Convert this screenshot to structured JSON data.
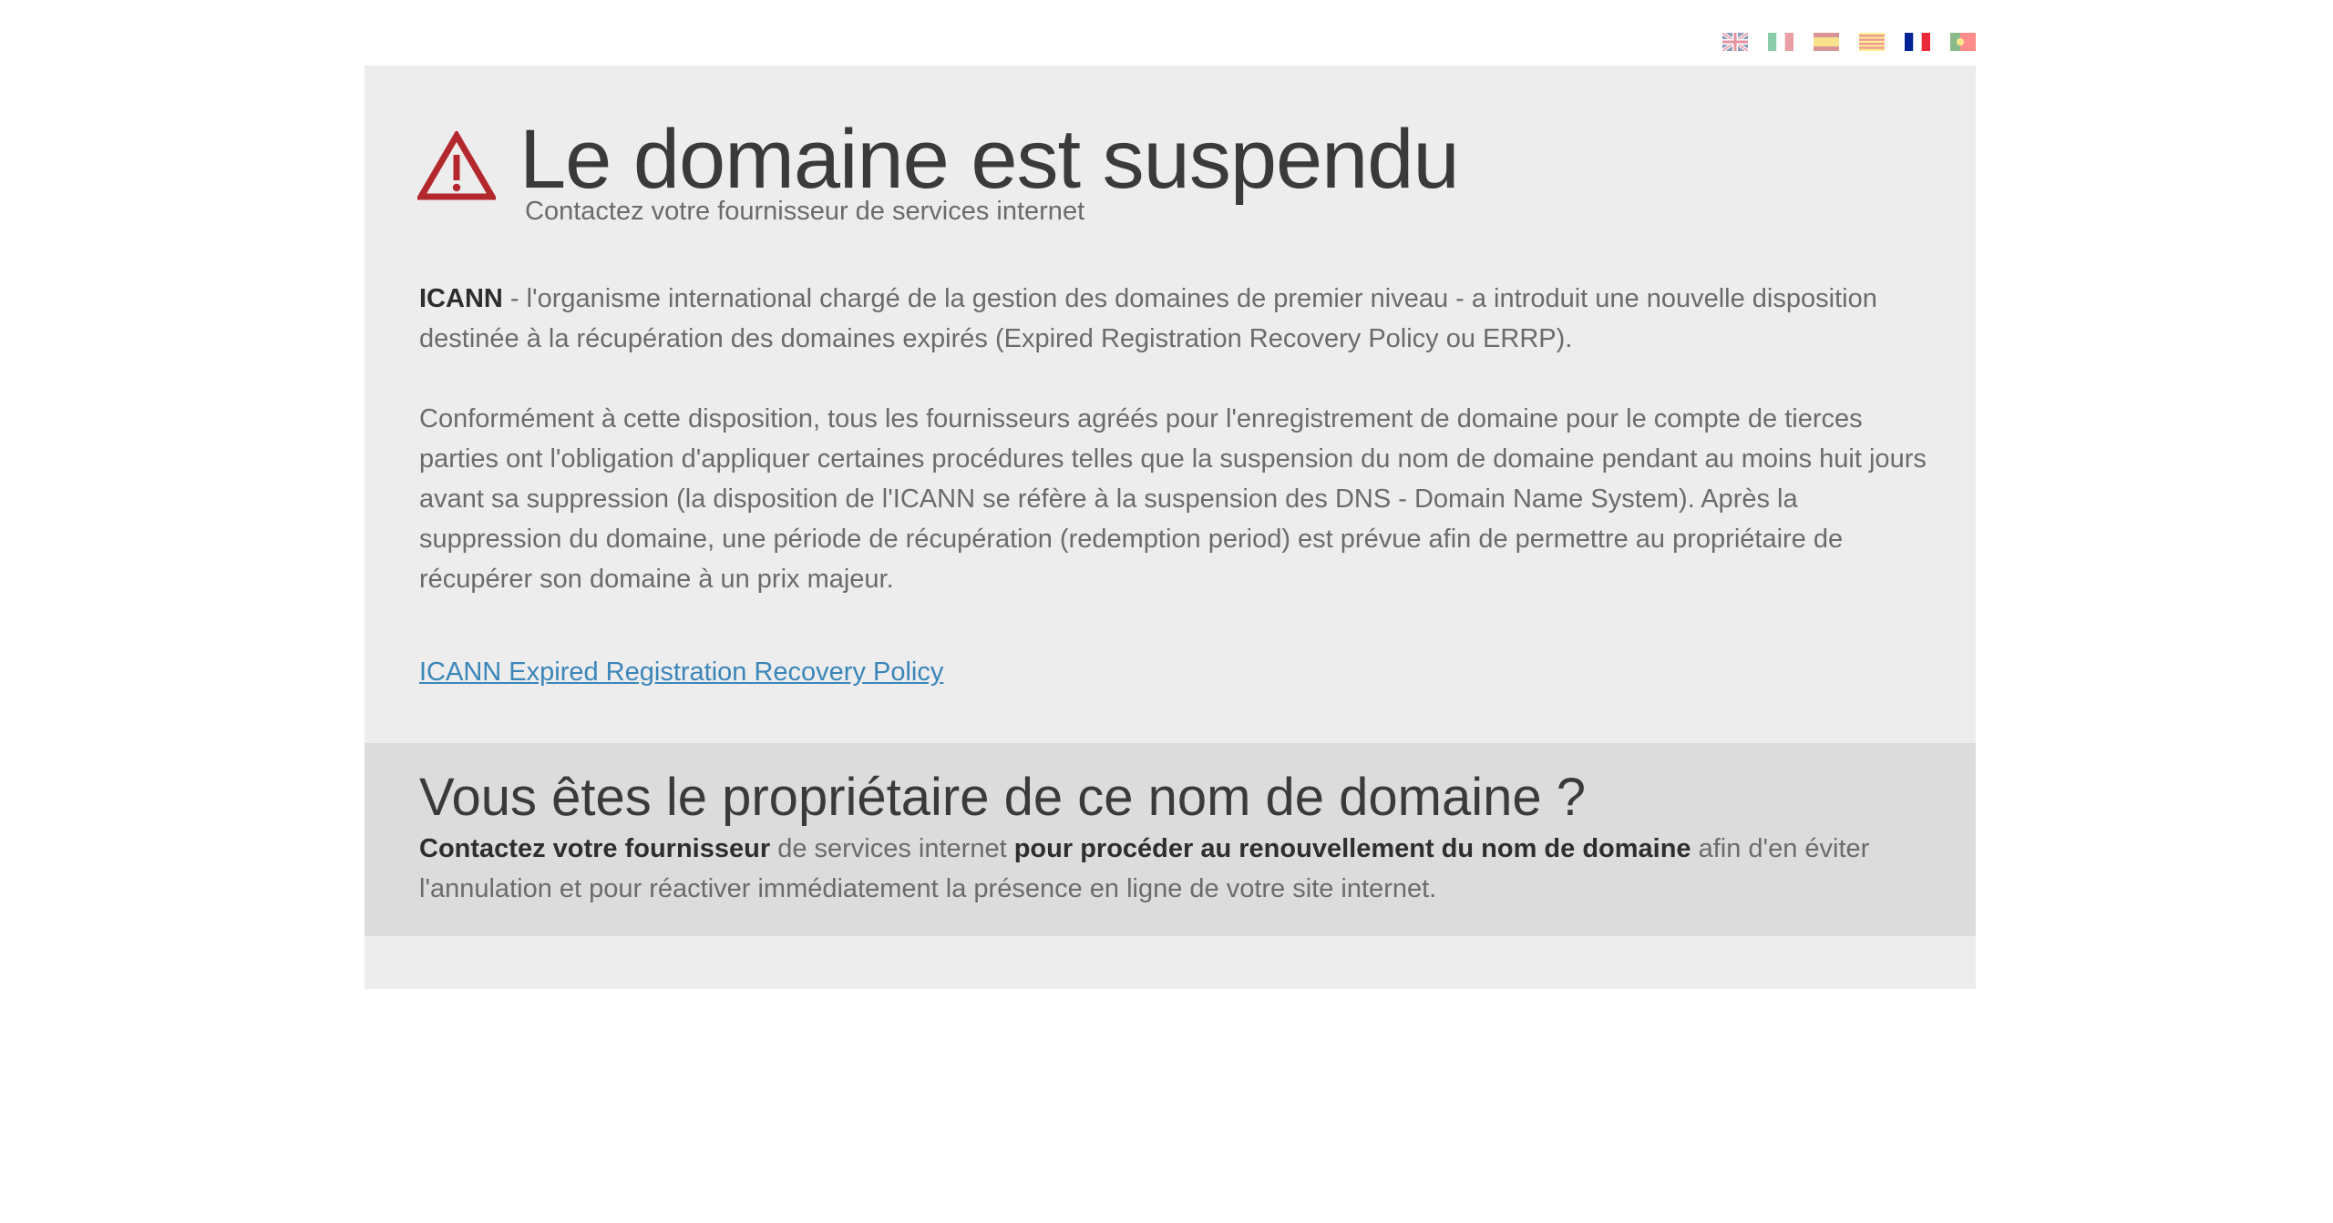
{
  "languages": [
    {
      "code": "en",
      "name": "English",
      "active": false
    },
    {
      "code": "it",
      "name": "Italiano",
      "active": false
    },
    {
      "code": "es",
      "name": "Español",
      "active": false
    },
    {
      "code": "ca",
      "name": "Català",
      "active": false
    },
    {
      "code": "fr",
      "name": "Français",
      "active": true
    },
    {
      "code": "pt",
      "name": "Português",
      "active": false
    }
  ],
  "header": {
    "title": "Le domaine est suspendu",
    "subtitle": "Contactez votre fournisseur de services internet",
    "icon": "warning-triangle-icon",
    "icon_color": "#b3282d"
  },
  "content": {
    "p1_strong": "ICANN",
    "p1_text": " - l'organisme international chargé de la gestion des domaines de premier niveau - a introduit une nouvelle disposition destinée à la récupération des domaines expirés (Expired Registration Recovery Policy ou ERRP).",
    "p2_text": "Conformément à cette disposition, tous les fournisseurs agréés pour l'enregistrement de domaine pour le compte de tierces parties ont l'obligation d'appliquer certaines procédures telles que la suspension du nom de domaine pendant au moins huit jours avant sa suppression (la disposition de l'ICANN se réfère à la suspension des DNS - Domain Name System). Après la suppression du domaine, une période de récupération (redemption period) est prévue afin de permettre au propriétaire de récupérer son domaine à un prix majeur.",
    "link_text": "ICANN Expired Registration Recovery Policy",
    "link_color": "#3a86b9"
  },
  "owner": {
    "title": "Vous êtes le propriétaire de ce nom de domaine ?",
    "s1": "Contactez votre fournisseur",
    "t1": " de services internet ",
    "s2": "pour procéder au renouvellement du nom de domaine",
    "t2": " afin d'en éviter l'annulation et pour réactiver immédiatement la présence en ligne de votre site internet."
  }
}
